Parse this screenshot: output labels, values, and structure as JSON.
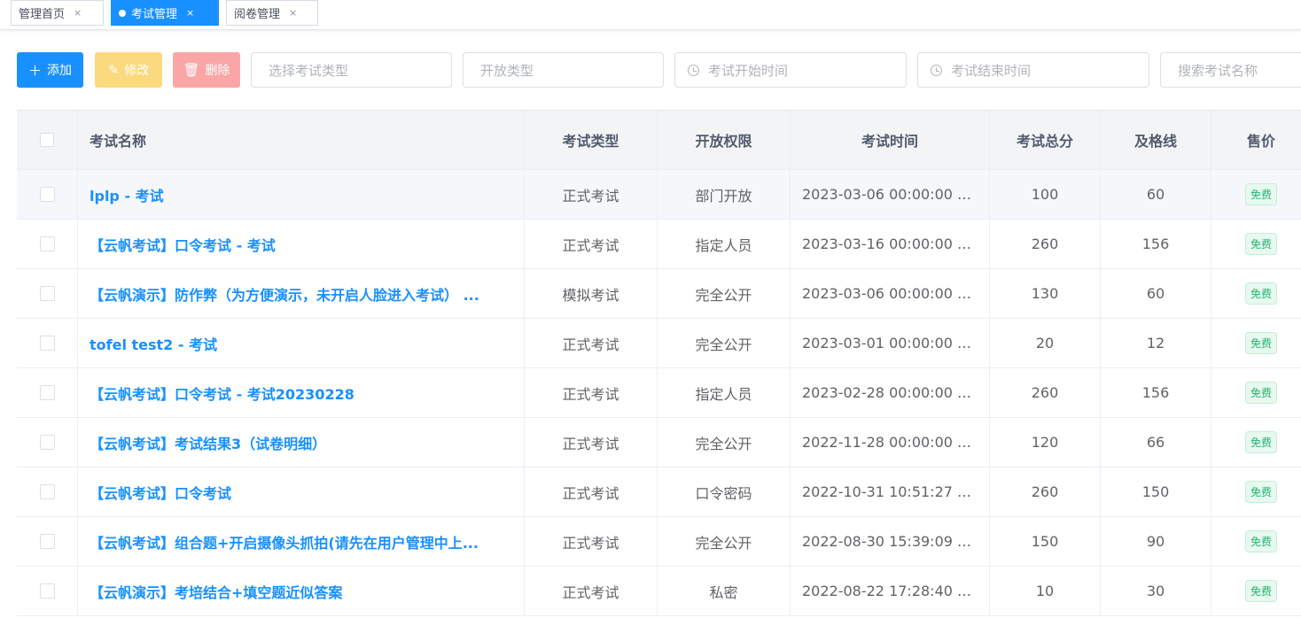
{
  "tabs": [
    {
      "label": "管理首页",
      "close": "×"
    },
    {
      "label": "考试管理",
      "close": "×"
    },
    {
      "label": "阅卷管理",
      "close": "×"
    }
  ],
  "toolbar": {
    "add_label": "添加",
    "edit_label": "修改",
    "delete_label": "删除",
    "exam_type_placeholder": "选择考试类型",
    "open_type_placeholder": "开放类型",
    "start_time_placeholder": "考试开始时间",
    "end_time_placeholder": "考试结束时间",
    "search_placeholder": "搜索考试名称"
  },
  "colors": {
    "primary": "#1890ff",
    "warning_button": "#fbd97e",
    "danger_button": "#fba6a6",
    "free_badge": "#21b56e"
  },
  "table": {
    "headers": [
      "考试名称",
      "考试类型",
      "开放权限",
      "考试时间",
      "考试总分",
      "及格线",
      "售价"
    ],
    "rows": [
      {
        "name": "lplp - 考试",
        "type": "正式考试",
        "access": "部门开放",
        "time": "2023-03-06 00:00:00 ~...",
        "total": "100",
        "pass": "60",
        "price": "免费"
      },
      {
        "name": "【云帆考试】口令考试 - 考试",
        "type": "正式考试",
        "access": "指定人员",
        "time": "2023-03-16 00:00:00 ~...",
        "total": "260",
        "pass": "156",
        "price": "免费"
      },
      {
        "name": "【云帆演示】防作弊（为方便演示，未开启人脸进入考试） ...",
        "type": "模拟考试",
        "access": "完全公开",
        "time": "2023-03-06 00:00:00 ~...",
        "total": "130",
        "pass": "60",
        "price": "免费"
      },
      {
        "name": "tofel test2 - 考试",
        "type": "正式考试",
        "access": "完全公开",
        "time": "2023-03-01 00:00:00 ~...",
        "total": "20",
        "pass": "12",
        "price": "免费"
      },
      {
        "name": "【云帆考试】口令考试 - 考试20230228",
        "type": "正式考试",
        "access": "指定人员",
        "time": "2023-02-28 00:00:00 ~...",
        "total": "260",
        "pass": "156",
        "price": "免费"
      },
      {
        "name": "【云帆考试】考试结果3（试卷明细）",
        "type": "正式考试",
        "access": "完全公开",
        "time": "2022-11-28 00:00:00 ~...",
        "total": "120",
        "pass": "66",
        "price": "免费"
      },
      {
        "name": "【云帆考试】口令考试",
        "type": "正式考试",
        "access": "口令密码",
        "time": "2022-10-31 10:51:27 ~...",
        "total": "260",
        "pass": "150",
        "price": "免费"
      },
      {
        "name": "【云帆考试】组合题+开启摄像头抓拍(请先在用户管理中上...",
        "type": "正式考试",
        "access": "完全公开",
        "time": "2022-08-30 15:39:09 ~...",
        "total": "150",
        "pass": "90",
        "price": "免费"
      },
      {
        "name": "【云帆演示】考培结合+填空题近似答案",
        "type": "正式考试",
        "access": "私密",
        "time": "2022-08-22 17:28:40 ~...",
        "total": "10",
        "pass": "30",
        "price": "免费"
      }
    ]
  }
}
